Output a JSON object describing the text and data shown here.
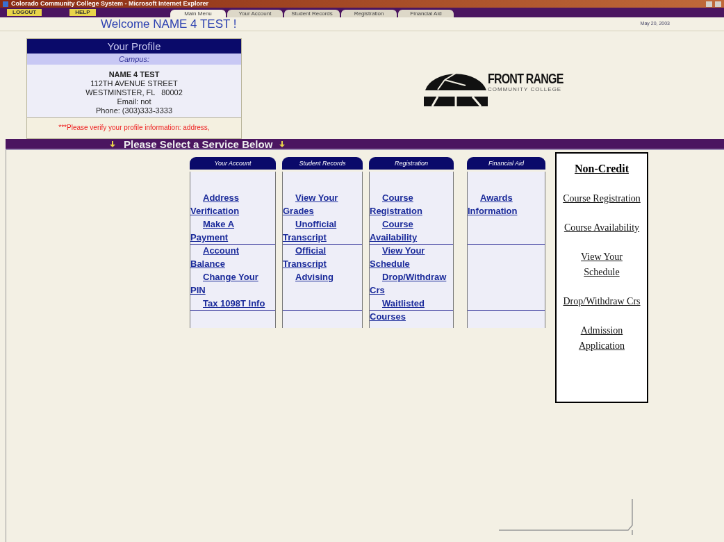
{
  "window": {
    "title": "Colorado Community College System - Microsoft Internet Explorer"
  },
  "top_buttons": [
    "LOGOUT",
    "HELP"
  ],
  "tabs": [
    {
      "label": "Main Menu",
      "selected": true
    },
    {
      "label": "Your Account",
      "selected": false
    },
    {
      "label": "Student Records",
      "selected": false
    },
    {
      "label": "Registration",
      "selected": false
    },
    {
      "label": "Financial Aid",
      "selected": false
    }
  ],
  "welcome": "Welcome NAME 4 TEST !",
  "date": "May 20, 2003",
  "profile": {
    "title": "Your Profile",
    "campus": "Campus:",
    "name": "NAME 4 TEST",
    "lines": [
      "112TH AVENUE STREET",
      "WESTMINSTER, FL   80002",
      "Email: not",
      "Phone: (303)333-3333"
    ],
    "warning": "***Please verify your profile information: address,"
  },
  "logo": {
    "name": "FRONT RANGE",
    "subtitle": "COMMUNITY COLLEGE"
  },
  "service_banner": "Please Select a Service Below",
  "service_columns": [
    {
      "title": "Your Account",
      "links": [
        "Address Verification",
        "Make A Payment",
        "Account Balance",
        "Change Your PIN",
        "Tax 1098T Info"
      ]
    },
    {
      "title": "Student Records",
      "links": [
        "View Your Grades",
        "Unofficial Transcript",
        "Official Transcript",
        "Advising"
      ]
    },
    {
      "title": "Registration",
      "links": [
        "Course Registration",
        "Course Availability",
        "View Your Schedule",
        "Drop/Withdraw Crs",
        "Waitlisted Courses"
      ]
    },
    {
      "title": "Financial Aid",
      "links": [
        "Awards Information"
      ]
    }
  ],
  "non_credit": {
    "title": "Non-Credit",
    "links": [
      "Course Registration",
      "Course Availability",
      "View Your Schedule",
      "Drop/Withdraw Crs",
      "Admission Application"
    ]
  }
}
